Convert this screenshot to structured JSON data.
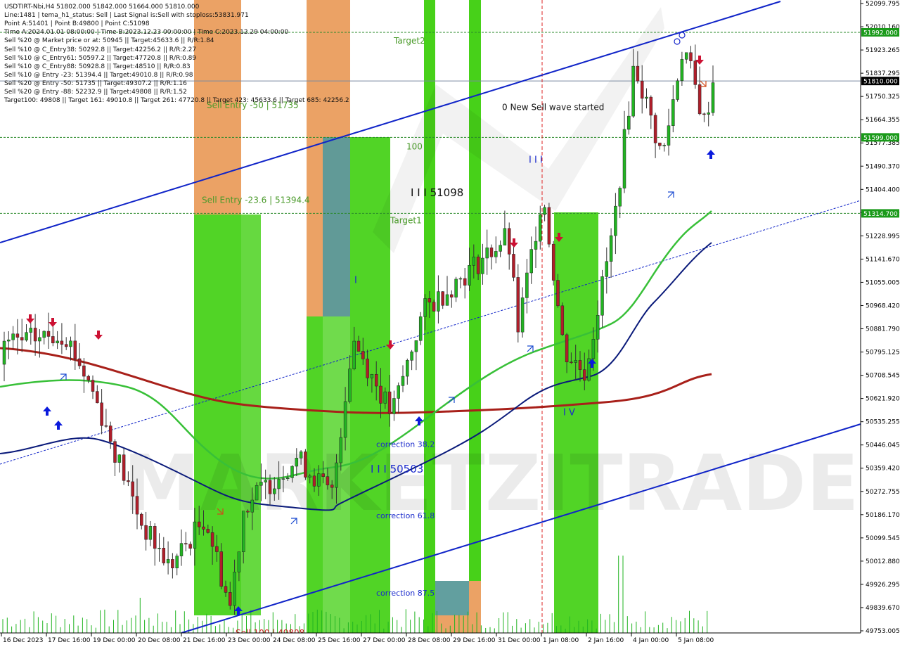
{
  "info_lines": [
    "USDTIRT-Nbi,H4  51802.000 51842.000 51664.000 51810.000",
    "Line:1481 | tema_h1_status: Sell | Last Signal is:Sell with stoploss:53831.971",
    "Point A:51401 | Point B:49800 | Point C:51098",
    "Time A:2024.01.01 08:00:00 | Time B:2023.12.23 00:00:00 | Time C:2023.12.29 04:00:00",
    "Sell %20 @ Market price or at: 50945 || Target:45633.6 || R/R:1.84",
    "Sell %10 @ C_Entry38: 50292.8 || Target:42256.2 || R/R:2.27",
    "Sell %10 @ C_Entry61: 50597.2 || Target:47720.8 || R/R:0.89",
    "Sell %10 @ C_Entry88: 50928.8 || Target:48510 || R/R:0.83",
    "Sell %10 @ Entry -23: 51394.4 || Target:49010.8 || R/R:0.98",
    "Sell %20 @ Entry -50: 51735 || Target:49307.2 || R/R:1.16",
    "Sell %20 @ Entry -88: 52232.9 || Target:49808 || R/R:1.52",
    "Target100: 49808 || Target 161: 49010.8 || Target 261: 47720.8 || Target 423: 45633.6 || Target 685: 42256.2"
  ],
  "price_axis": [
    "52099.795",
    "52010.160",
    "51923.265",
    "51837.295",
    "51750.325",
    "51664.355",
    "51577.385",
    "51490.370",
    "51404.400",
    "51317.430",
    "51228.995",
    "51141.670",
    "51055.005",
    "50968.420",
    "50881.790",
    "50795.125",
    "50708.545",
    "50621.920",
    "50535.255",
    "50446.045",
    "50359.420",
    "50272.755",
    "50186.170",
    "50099.545",
    "50012.880",
    "49926.295",
    "49839.670",
    "49753.005"
  ],
  "price_labels": [
    {
      "text": "51992.000",
      "price": 51992,
      "bg": "#1a9a1a",
      "fg": "#ffffff"
    },
    {
      "text": "51810.000",
      "price": 51810,
      "bg": "#000000",
      "fg": "#ffffff"
    },
    {
      "text": "51599.000",
      "price": 51599,
      "bg": "#1a9a1a",
      "fg": "#ffffff"
    },
    {
      "text": "51314.700",
      "price": 51314.7,
      "bg": "#1a9a1a",
      "fg": "#ffffff"
    }
  ],
  "time_axis": [
    "16 Dec 2023",
    "17 Dec 16:00",
    "19 Dec 00:00",
    "20 Dec 08:00",
    "21 Dec 16:00",
    "23 Dec 00:00",
    "24 Dec 08:00",
    "25 Dec 16:00",
    "27 Dec 00:00",
    "28 Dec 08:00",
    "29 Dec 16:00",
    "31 Dec 00:00",
    "1 Jan 08:00",
    "2 Jan 16:00",
    "4 Jan 00:00",
    "5 Jan 08:00"
  ],
  "annotations": [
    {
      "text": "Target2",
      "price": 51960,
      "color": "#4a9a2a",
      "size": 12
    },
    {
      "text": "Sell Entry -50 | 51735",
      "price": 51720,
      "color": "#4a9a2a",
      "size": 12
    },
    {
      "text": "0 New Sell wave started",
      "price": 51712,
      "color": "#111111",
      "size": 12
    },
    {
      "text": "100",
      "price": 51565,
      "color": "#4a9a2a",
      "size": 12
    },
    {
      "text": "I I I",
      "price": 51515,
      "color": "#1a2acc",
      "size": 13
    },
    {
      "text": "I I I 51098",
      "price": 51390,
      "color": "#111111",
      "size": 15
    },
    {
      "text": "Sell Entry -23.6 | 51394.4",
      "price": 51365,
      "color": "#4a9a2a",
      "size": 12
    },
    {
      "text": "Target1",
      "price": 51288,
      "color": "#4a9a2a",
      "size": 12
    },
    {
      "text": "I",
      "price": 51065,
      "color": "#1a2acc",
      "size": 13
    },
    {
      "text": "I V",
      "price": 50570,
      "color": "#1a2acc",
      "size": 13
    },
    {
      "text": "correction 38.2",
      "price": 50452,
      "color": "#1a2acc",
      "size": 11
    },
    {
      "text": "I I I 50503",
      "price": 50355,
      "color": "#1a2acc",
      "size": 15
    },
    {
      "text": "correction 61.8",
      "price": 50185,
      "color": "#1a2acc",
      "size": 11
    },
    {
      "text": "correction 87.5",
      "price": 49895,
      "color": "#1a2acc",
      "size": 11
    },
    {
      "text": "Sell 100 | 49808",
      "price": 49745,
      "color": "#cc2222",
      "size": 12
    }
  ],
  "watermark": "MARKETZITRADE",
  "colors": {
    "bull": "#22b422",
    "bear": "#b01e2a",
    "sma_red": "#a8201a",
    "line_green": "#38c038",
    "line_navy": "#0a1a7a",
    "channel": "#1024c8",
    "bright_green": "#33cc00",
    "orange": "#e8924a",
    "teal": "#5a9a9a"
  }
}
